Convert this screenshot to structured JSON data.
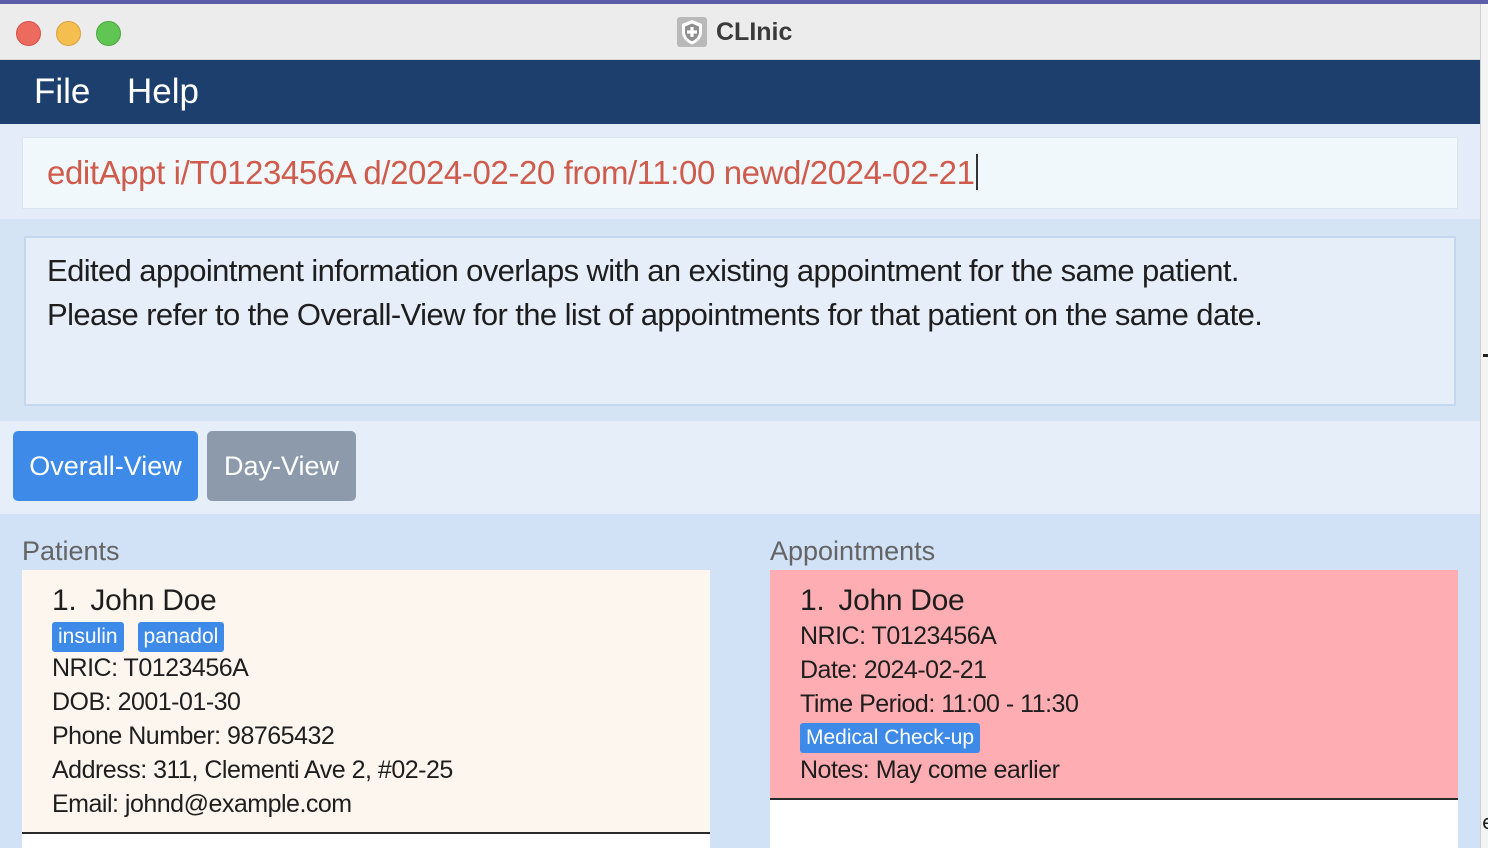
{
  "window": {
    "title": "CLInic",
    "app_icon": "shield-plus-icon"
  },
  "menu": {
    "file_label": "File",
    "help_label": "Help"
  },
  "command_box": {
    "value": "editAppt i/T0123456A d/2024-02-20 from/11:00 newd/2024-02-21"
  },
  "result_display": {
    "lines": [
      "Edited appointment information overlaps with an existing appointment for the same patient.",
      "Please refer to the Overall-View for the list of appointments for that patient on the same date."
    ]
  },
  "tabs": [
    {
      "label": "Overall-View",
      "selected": true
    },
    {
      "label": "Day-View",
      "selected": false
    }
  ],
  "patients": {
    "title": "Patients",
    "items": [
      {
        "index": "1.",
        "name": "John Doe",
        "tags": [
          "insulin",
          "panadol"
        ],
        "nric": "NRIC: T0123456A",
        "dob": "DOB: 2001-01-30",
        "phone": "Phone Number: 98765432",
        "address": "Address: 311, Clementi Ave 2, #02-25",
        "email": "Email: johnd@example.com"
      }
    ]
  },
  "appointments": {
    "title": "Appointments",
    "items": [
      {
        "index": "1.",
        "name": "John Doe",
        "nric": "NRIC: T0123456A",
        "date": "Date: 2024-02-21",
        "time_period": "Time Period: 11:00 - 11:30",
        "tag": "Medical Check-up",
        "notes": "Notes: May come earlier"
      }
    ]
  },
  "colors": {
    "menubar": "#1d3f6e",
    "command_text": "#cf5b4c",
    "tab_selected": "#3d8ae8",
    "tab_unselected": "#8c9aac",
    "tag": "#3d8ae8",
    "patient_card": "#fdf6ef",
    "appointment_card_warning": "#feaeb3"
  }
}
